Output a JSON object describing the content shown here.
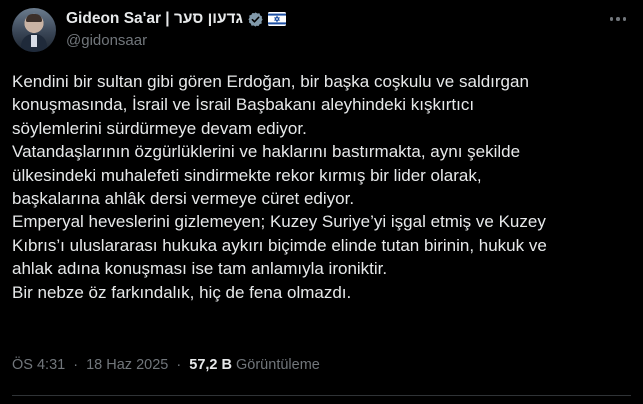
{
  "author": {
    "display_name": "Gideon Sa'ar | גדעון סער",
    "handle": "@gidonsaar",
    "verified_icon": "verified-badge-icon",
    "flag_icon": "israel-flag-icon"
  },
  "menu": {
    "icon": "more-options-icon"
  },
  "tweet": {
    "lines": [
      "Kendini bir sultan gibi gören Erdoğan, bir başka coşkulu ve saldırgan",
      "konuşmasında, İsrail ve İsrail Başbakanı aleyhindeki kışkırtıcı",
      "söylemlerini sürdürmeye devam ediyor.",
      "Vatandaşlarının özgürlüklerini ve haklarını bastırmakta, aynı şekilde",
      "ülkesindeki muhalefeti sindirmekte rekor kırmış bir lider olarak,",
      "başkalarına ahlâk dersi vermeye cüret ediyor.",
      "Emperyal heveslerini gizlemeyen; Kuzey Suriye’yi işgal etmiş ve Kuzey",
      "Kıbrıs’ı uluslararası hukuka aykırı biçimde elinde tutan birinin, hukuk ve",
      "ahlak adına konuşması ise tam anlamıyla ironiktir.",
      "Bir nebze öz farkındalık, hiç de fena olmazdı."
    ]
  },
  "meta": {
    "time": "ÖS 4:31",
    "separator_1": "·",
    "date": "18 Haz 2025",
    "separator_2": "·",
    "views_count": "57,2 B",
    "views_label": "Görüntüleme"
  },
  "colors": {
    "background": "#000000",
    "text_primary": "#e7e9ea",
    "text_secondary": "#71767b",
    "verified_badge": "#829aab",
    "flag_blue": "#1d4fa3"
  }
}
